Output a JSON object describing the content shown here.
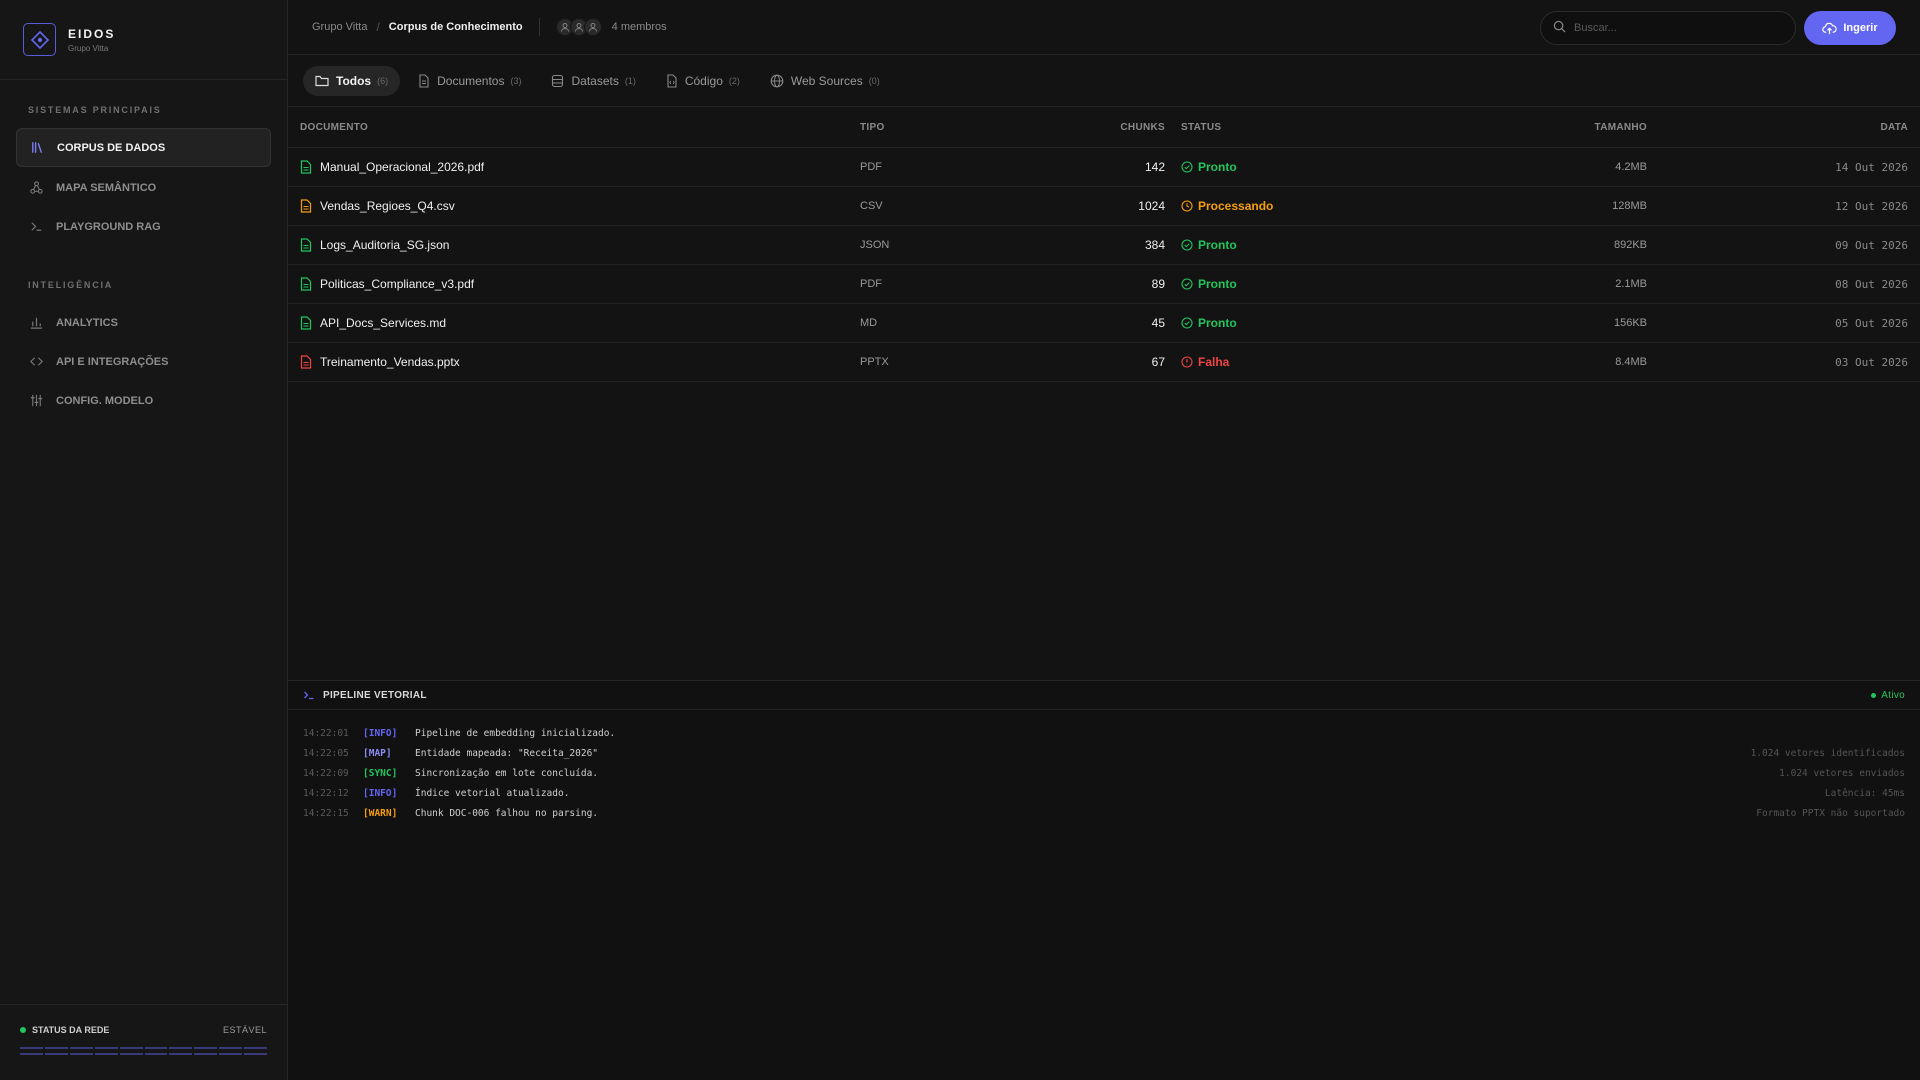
{
  "brand": {
    "name": "EIDOS",
    "subtitle": "Grupo Vitta"
  },
  "sidebar": {
    "section1_label": "Sistemas Principais",
    "section1_items": [
      {
        "label": "CORPUS DE DADOS",
        "icon": "library-icon",
        "active": true
      },
      {
        "label": "MAPA SEMÂNTICO",
        "icon": "graph-icon",
        "active": false
      },
      {
        "label": "PLAYGROUND RAG",
        "icon": "terminal-icon",
        "active": false
      }
    ],
    "section2_label": "Inteligência",
    "section2_items": [
      {
        "label": "ANALYTICS",
        "icon": "bar-chart-icon"
      },
      {
        "label": "API E INTEGRAÇÕES",
        "icon": "code-icon"
      },
      {
        "label": "CONFIG. MODELO",
        "icon": "sliders-icon"
      }
    ],
    "network": {
      "label": "STATUS DA REDE",
      "value": "ESTÁVEL"
    }
  },
  "header": {
    "breadcrumb_root": "Grupo Vitta",
    "breadcrumb_sep": "/",
    "breadcrumb_current": "Corpus de Conhecimento",
    "members": "4 membros",
    "search_placeholder": "Buscar...",
    "ingest_label": "Ingerir"
  },
  "tabs": [
    {
      "label": "Todos",
      "count": "(6)",
      "icon": "folder-icon",
      "active": true
    },
    {
      "label": "Documentos",
      "count": "(3)",
      "icon": "file-icon"
    },
    {
      "label": "Datasets",
      "count": "(1)",
      "icon": "database-icon"
    },
    {
      "label": "Código",
      "count": "(2)",
      "icon": "code-file-icon"
    },
    {
      "label": "Web Sources",
      "count": "(0)",
      "icon": "globe-icon"
    }
  ],
  "table": {
    "headers": {
      "doc": "DOCUMENTO",
      "type": "TIPO",
      "chunks": "CHUNKS",
      "status": "STATUS",
      "size": "TAMANHO",
      "date": "DATA"
    },
    "rows": [
      {
        "name": "Manual_Operacional_2026.pdf",
        "type": "PDF",
        "chunks": "142",
        "status": "Pronto",
        "size": "4.2MB",
        "date": "14 Out 2026"
      },
      {
        "name": "Vendas_Regioes_Q4.csv",
        "type": "CSV",
        "chunks": "1024",
        "status": "Processando",
        "size": "128MB",
        "date": "12 Out 2026"
      },
      {
        "name": "Logs_Auditoria_SG.json",
        "type": "JSON",
        "chunks": "384",
        "status": "Pronto",
        "size": "892KB",
        "date": "09 Out 2026"
      },
      {
        "name": "Politicas_Compliance_v3.pdf",
        "type": "PDF",
        "chunks": "89",
        "status": "Pronto",
        "size": "2.1MB",
        "date": "08 Out 2026"
      },
      {
        "name": "API_Docs_Services.md",
        "type": "MD",
        "chunks": "45",
        "status": "Pronto",
        "size": "156KB",
        "date": "05 Out 2026"
      },
      {
        "name": "Treinamento_Vendas.pptx",
        "type": "PPTX",
        "chunks": "67",
        "status": "Falha",
        "size": "8.4MB",
        "date": "03 Out 2026"
      }
    ]
  },
  "pipeline": {
    "title": "PIPELINE VETORIAL",
    "status": "Ativo",
    "logs": [
      {
        "time": "14:22:01",
        "tag": "[INFO]",
        "msg": "Pipeline de embedding inicializado.",
        "meta": ""
      },
      {
        "time": "14:22:05",
        "tag": "[MAP]",
        "msg": "Entidade mapeada: \"Receita_2026\"",
        "meta": "1.024 vetores identificados"
      },
      {
        "time": "14:22:09",
        "tag": "[SYNC]",
        "msg": "Sincronização em lote concluída.",
        "meta": "1.024 vetores enviados"
      },
      {
        "time": "14:22:12",
        "tag": "[INFO]",
        "msg": "Índice vetorial atualizado.",
        "meta": "Latência: 45ms"
      },
      {
        "time": "14:22:15",
        "tag": "[WARN]",
        "msg": "Chunk DOC-006 falhou no parsing.",
        "meta": "Formato PPTX não suportado"
      }
    ]
  },
  "colors": {
    "accent": "#6366f1",
    "ok": "#22c55e",
    "processing": "#f59e0b",
    "fail": "#ef4444"
  }
}
